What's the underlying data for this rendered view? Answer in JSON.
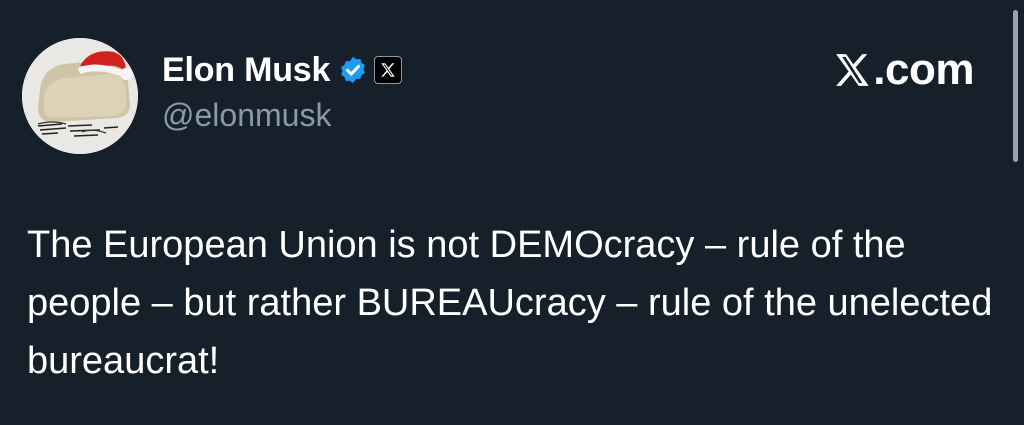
{
  "tweet": {
    "author": {
      "display_name": "Elon Musk",
      "handle": "@elonmusk",
      "verified_icon": "verified-badge-icon",
      "affiliate_icon": "x-logo-icon",
      "avatar_icon": "avatar-image"
    },
    "text": "The European Union is not DEMOcracy – rule of the people – but rather BUREAUcracy – rule of the unelected bureaucrat!"
  },
  "brand": {
    "label": ".com",
    "icon": "x-logo-icon"
  },
  "colors": {
    "background": "#15202b",
    "text_primary": "#ffffff",
    "text_secondary": "#8b98a5",
    "verified_blue": "#1d9bf0"
  }
}
